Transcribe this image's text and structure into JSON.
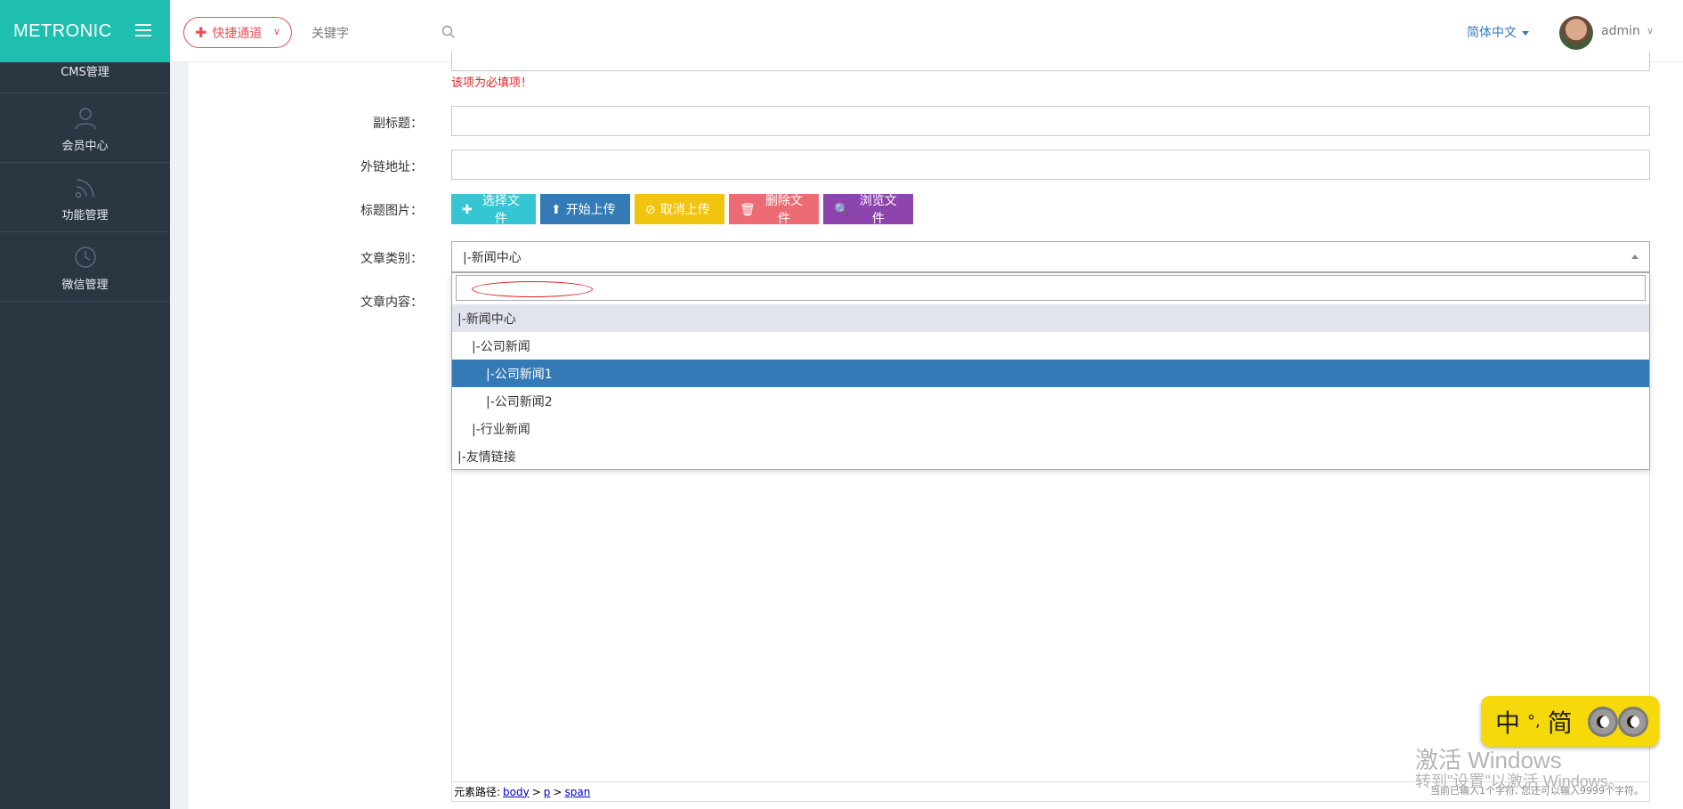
{
  "header": {
    "logo": "METRONIC",
    "quick_access": "快捷通道",
    "search_placeholder": "关键字",
    "language": "简体中文",
    "user": "admin"
  },
  "sidebar": {
    "items": [
      {
        "label": "CMS管理",
        "icon": "cms-icon"
      },
      {
        "label": "会员中心",
        "icon": "user-icon"
      },
      {
        "label": "功能管理",
        "icon": "rss-icon"
      },
      {
        "label": "微信管理",
        "icon": "clock-icon"
      }
    ]
  },
  "form": {
    "title_error": "该项为必填项！",
    "subtitle_label": "副标题：",
    "link_label": "外链地址：",
    "image_label": "标题图片：",
    "category_label": "文章类别：",
    "content_label": "文章内容：",
    "category_value": "|-新闻中心",
    "subtitle_value": "",
    "link_value": ""
  },
  "upload": {
    "select": "选择文件",
    "start": "开始上传",
    "cancel": "取消上传",
    "delete": "删除文件",
    "browse": "浏览文件"
  },
  "dropdown": {
    "search_value": "",
    "options": [
      {
        "label": "|-新闻中心",
        "state": "highlighted",
        "level": 0
      },
      {
        "label": "|-公司新闻",
        "state": "",
        "level": 1
      },
      {
        "label": "|-公司新闻1",
        "state": "selected",
        "level": 2
      },
      {
        "label": "|-公司新闻2",
        "state": "",
        "level": 2
      },
      {
        "label": "|-行业新闻",
        "state": "",
        "level": 1
      },
      {
        "label": "|-友情链接",
        "state": "",
        "level": 0
      }
    ]
  },
  "editor": {
    "path_label": "元素路径:",
    "path": [
      "body",
      "p",
      "span"
    ],
    "path_sep": ">",
    "count": "当前已输入1个字符, 您还可以输入9999个字符。"
  },
  "ime": {
    "zh": "中",
    "punct": "°,",
    "mode": "简"
  },
  "watermark": {
    "line1": "激活 Windows",
    "line2": "转到\"设置\"以激活 Windows。"
  },
  "colors": {
    "accent": "#1ebfae",
    "sidebar": "#2b3643",
    "primary": "#337ab7",
    "danger": "#e7505a"
  }
}
